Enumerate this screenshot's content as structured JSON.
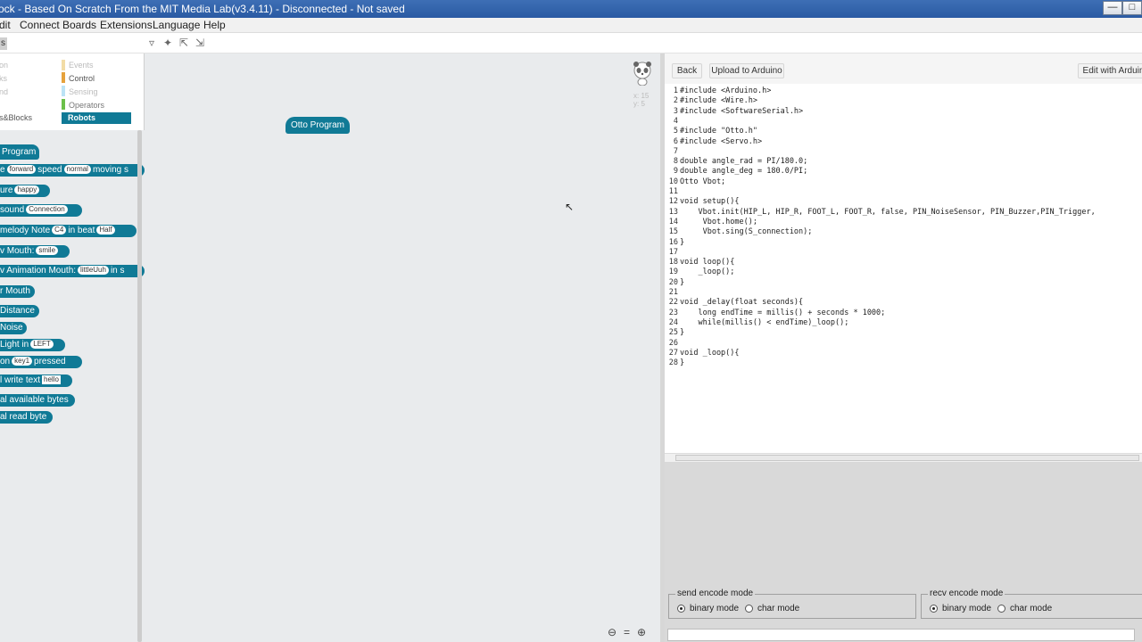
{
  "window": {
    "title": "ock - Based On Scratch From the MIT Media Lab(v3.4.11) - Disconnected - Not saved",
    "buttons": [
      "—",
      "□"
    ]
  },
  "menu": [
    "dit",
    "Connect",
    "Boards",
    "Extensions",
    "Language",
    "Help"
  ],
  "toolbar": {
    "tab_stub": "s"
  },
  "categories_left": [
    "on",
    "ks",
    "nd",
    "s&Blocks"
  ],
  "categories_right": [
    {
      "label": "Events",
      "color": "#e9c46a"
    },
    {
      "label": "Control",
      "color": "#e6a23c"
    },
    {
      "label": "Sensing",
      "color": "#8ed1f0"
    },
    {
      "label": "Operators",
      "color": "#6cc04a"
    }
  ],
  "robots_tab": "Robots",
  "blocks": [
    {
      "text": "Program"
    },
    {
      "pre": "e",
      "dd1": "forward",
      "mid": "speed",
      "dd2": "normal",
      "post": "moving s"
    },
    {
      "pre": "ure",
      "dd1": "happy"
    },
    {
      "pre": "sound",
      "dd1": "Connection"
    },
    {
      "pre": "melody  Note",
      "dd1": "C4",
      "mid": "in beat",
      "dd2": "Half"
    },
    {
      "pre": "v Mouth:",
      "dd1": "smile"
    },
    {
      "pre": "v  Animation Mouth:",
      "dd1": "littleUuh",
      "post": "in s"
    },
    {
      "text": "r Mouth"
    },
    {
      "text": "Distance"
    },
    {
      "text": "Noise"
    },
    {
      "pre": "Light  in",
      "dd1": "LEFT"
    },
    {
      "pre": "on",
      "dd1": "key1",
      "post": "pressed"
    },
    {
      "pre": "l  write text",
      "txt": "hello"
    },
    {
      "text": "al available bytes"
    },
    {
      "text": "al read byte"
    }
  ],
  "workspace": {
    "hat_block": "Otto Program",
    "x_readout": "x: 15",
    "y_readout": "y: 5",
    "zoom_icons": [
      "⊖",
      "=",
      "⊕"
    ]
  },
  "code_panel": {
    "back_button": "Back",
    "upload_button": "Upload to Arduino",
    "edit_button": "Edit with Arduin",
    "lines": [
      "#include <Arduino.h>",
      "#include <Wire.h>",
      "#include <SoftwareSerial.h>",
      "",
      "#include \"Otto.h\"",
      "#include <Servo.h>",
      "",
      "double angle_rad = PI/180.0;",
      "double angle_deg = 180.0/PI;",
      "Otto Vbot;",
      "",
      "void setup(){",
      "    Vbot.init(HIP_L, HIP_R, FOOT_L, FOOT_R, false, PIN_NoiseSensor, PIN_Buzzer,PIN_Trigger,",
      "     Vbot.home();",
      "     Vbot.sing(S_connection);",
      "}",
      "",
      "void loop(){",
      "    _loop();",
      "}",
      "",
      "void _delay(float seconds){",
      "    long endTime = millis() + seconds * 1000;",
      "    while(millis() < endTime)_loop();",
      "}",
      "",
      "void _loop(){",
      "}"
    ]
  },
  "serial": {
    "send_legend": "send encode mode",
    "recv_legend": "recv encode mode",
    "binary_label": "binary mode",
    "char_label": "char mode",
    "send_mode": "binary",
    "recv_mode": "binary"
  },
  "colors": {
    "block": "#107a96",
    "titlebar": "#2a5aa3"
  }
}
